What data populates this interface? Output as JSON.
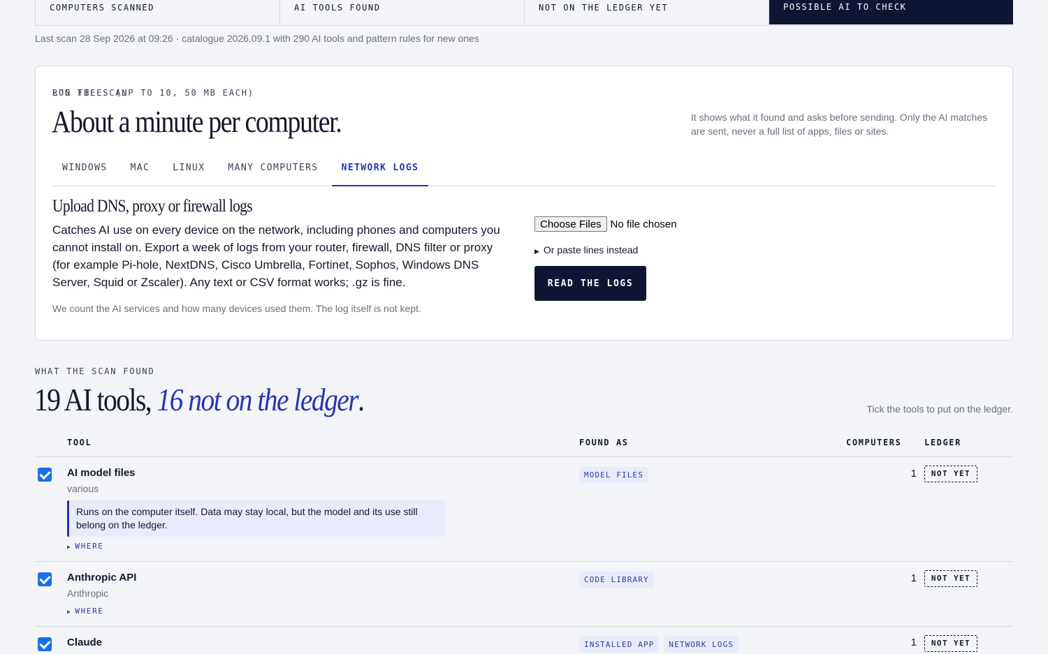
{
  "stats": [
    {
      "label": "COMPUTERS SCANNED"
    },
    {
      "label": "AI TOOLS FOUND"
    },
    {
      "label": "NOT ON THE LEDGER YET"
    },
    {
      "label": "POSSIBLE AI TO CHECK"
    }
  ],
  "scan_meta": "Last scan 28 Sep 2026 at 09:26 · catalogue 2026.09.1 with 290 AI tools and pattern rules for new ones",
  "run": {
    "eyebrow": "RUN THE SCAN",
    "title": "About a minute per computer.",
    "side_note": "It shows what it found and asks before sending. Only the AI matches are sent, never a full list of apps, files or sites.",
    "tabs": [
      "WINDOWS",
      "MAC",
      "LINUX",
      "MANY COMPUTERS",
      "NETWORK LOGS"
    ],
    "active_tab": "NETWORK LOGS",
    "upload_title": "Upload DNS, proxy or firewall logs",
    "upload_desc": "Catches AI use on every device on the network, including phones and computers you cannot install on. Export a week of logs from your router, firewall, DNS filter or proxy (for example Pi-hole, NextDNS, Cisco Umbrella, Fortinet, Sophos, Windows DNS Server, Squid or Zscaler). Any text or CSV format works; .gz is fine.",
    "upload_foot": "We count the AI services and how many devices used them. The log itself is not kept.",
    "files_label": "LOG FILES (UP TO 10, 50 MB EACH)",
    "choose_files": "Choose Files",
    "no_file": "No file chosen",
    "paste_toggle": "Or paste lines instead",
    "read_button": "READ THE LOGS"
  },
  "results": {
    "eyebrow": "WHAT THE SCAN FOUND",
    "title_start": "19 AI tools, ",
    "title_em": "16 not on the ledger",
    "title_end": ".",
    "tick_hint": "Tick the tools to put on the ledger.",
    "columns": {
      "tool": "TOOL",
      "found_as": "FOUND AS",
      "computers": "COMPUTERS",
      "ledger": "LEDGER"
    },
    "where_label": "WHERE",
    "rows": [
      {
        "name": "AI model files",
        "vendor": "various",
        "checked": true,
        "note": "Runs on the computer itself. Data may stay local, but the model and its use still belong on the ledger.",
        "found_as": [
          "MODEL FILES"
        ],
        "computers": "1",
        "ledger": "NOT YET"
      },
      {
        "name": "Anthropic API",
        "vendor": "Anthropic",
        "checked": true,
        "found_as": [
          "CODE LIBRARY"
        ],
        "computers": "1",
        "ledger": "NOT YET"
      },
      {
        "name": "Claude",
        "vendor": "",
        "checked": true,
        "found_as": [
          "INSTALLED APP",
          "NETWORK LOGS"
        ],
        "computers": "1",
        "ledger": "NOT YET"
      }
    ]
  },
  "colors": {
    "accent": "#2436b2",
    "dark": "#0f1634",
    "checkbox": "#1a6fe8",
    "tag_bg": "#e8ebfc"
  }
}
